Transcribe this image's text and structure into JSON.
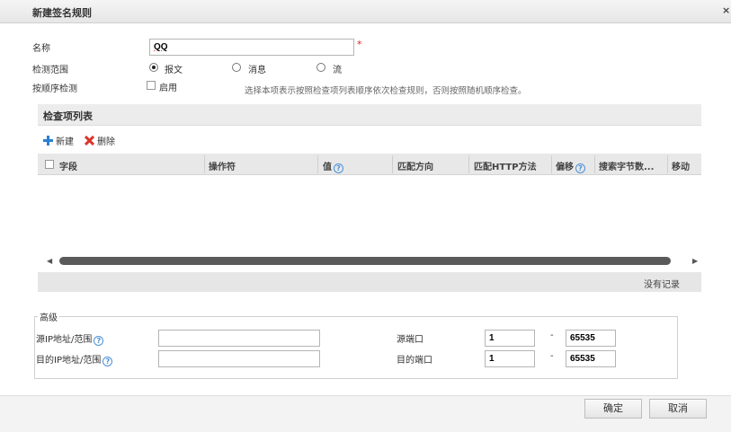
{
  "dialog": {
    "title": "新建签名规则",
    "close_label": "×"
  },
  "form": {
    "name_label": "名称",
    "name_value": "QQ",
    "required_mark": "*",
    "scope_label": "检测范围",
    "scope_options": [
      "报文",
      "消息",
      "流"
    ],
    "scope_selected": "报文",
    "order_label": "按顺序检测",
    "order_checkbox_label": "启用",
    "order_hint": "选择本项表示按照检查项列表顺序依次检查规则，否则按照随机顺序检查。"
  },
  "check_list": {
    "title": "检查项列表",
    "new_label": "新建",
    "delete_label": "删除",
    "columns": [
      "字段",
      "操作符",
      "值",
      "匹配方向",
      "匹配HTTP方法",
      "偏移",
      "搜索字节数...",
      "移动"
    ],
    "empty_text": "没有记录"
  },
  "advanced": {
    "legend": "高级",
    "src_ip_label": "源IP地址/范围",
    "dst_ip_label": "目的IP地址/范围",
    "src_port_label": "源端口",
    "dst_port_label": "目的端口",
    "src_port_from": "1",
    "src_port_to": "65535",
    "dst_port_from": "1",
    "dst_port_to": "65535",
    "range_sep": "-"
  },
  "buttons": {
    "ok": "确定",
    "cancel": "取消"
  },
  "colors": {
    "required": "#e02020",
    "add_icon": "#2a7fd4",
    "delete_icon": "#d9342b"
  }
}
